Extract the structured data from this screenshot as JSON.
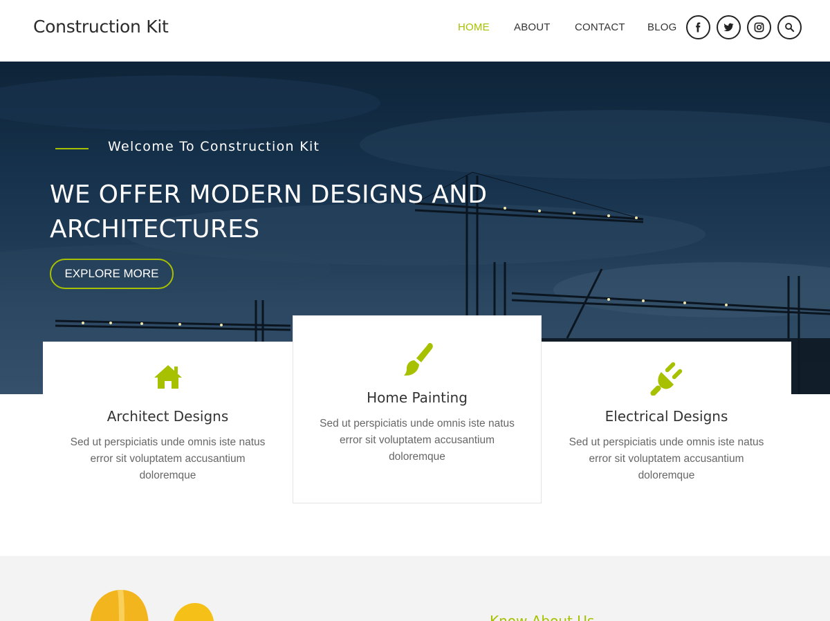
{
  "header": {
    "brand": "Construction Kit",
    "nav": [
      {
        "label": "HOME",
        "active": true
      },
      {
        "label": "ABOUT",
        "active": false
      },
      {
        "label": "CONTACT",
        "active": false
      },
      {
        "label": "BLOG",
        "active": false
      }
    ],
    "social_icons": [
      "facebook-icon",
      "twitter-icon",
      "instagram-icon",
      "search-icon"
    ]
  },
  "hero": {
    "subtitle": "Welcome To Construction Kit",
    "title": "WE OFFER MODERN DESIGNS AND ARCHITECTURES",
    "button_label": "EXPLORE MORE"
  },
  "services": [
    {
      "icon": "home-icon",
      "title": "Architect Designs",
      "text": "Sed ut perspiciatis unde omnis iste natus error sit voluptatem accusantium doloremque"
    },
    {
      "icon": "paint-brush-icon",
      "title": "Home Painting",
      "text": "Sed ut perspiciatis unde omnis iste natus error sit voluptatem accusantium doloremque"
    },
    {
      "icon": "plug-icon",
      "title": "Electrical Designs",
      "text": "Sed ut perspiciatis unde omnis iste natus error sit voluptatem accusantium doloremque"
    }
  ],
  "about": {
    "label": "Know About Us"
  },
  "colors": {
    "accent": "#a7c000",
    "text": "#333333",
    "muted": "#666666",
    "hero_bg": "#15304a",
    "section_bg": "#f3f3f3"
  }
}
